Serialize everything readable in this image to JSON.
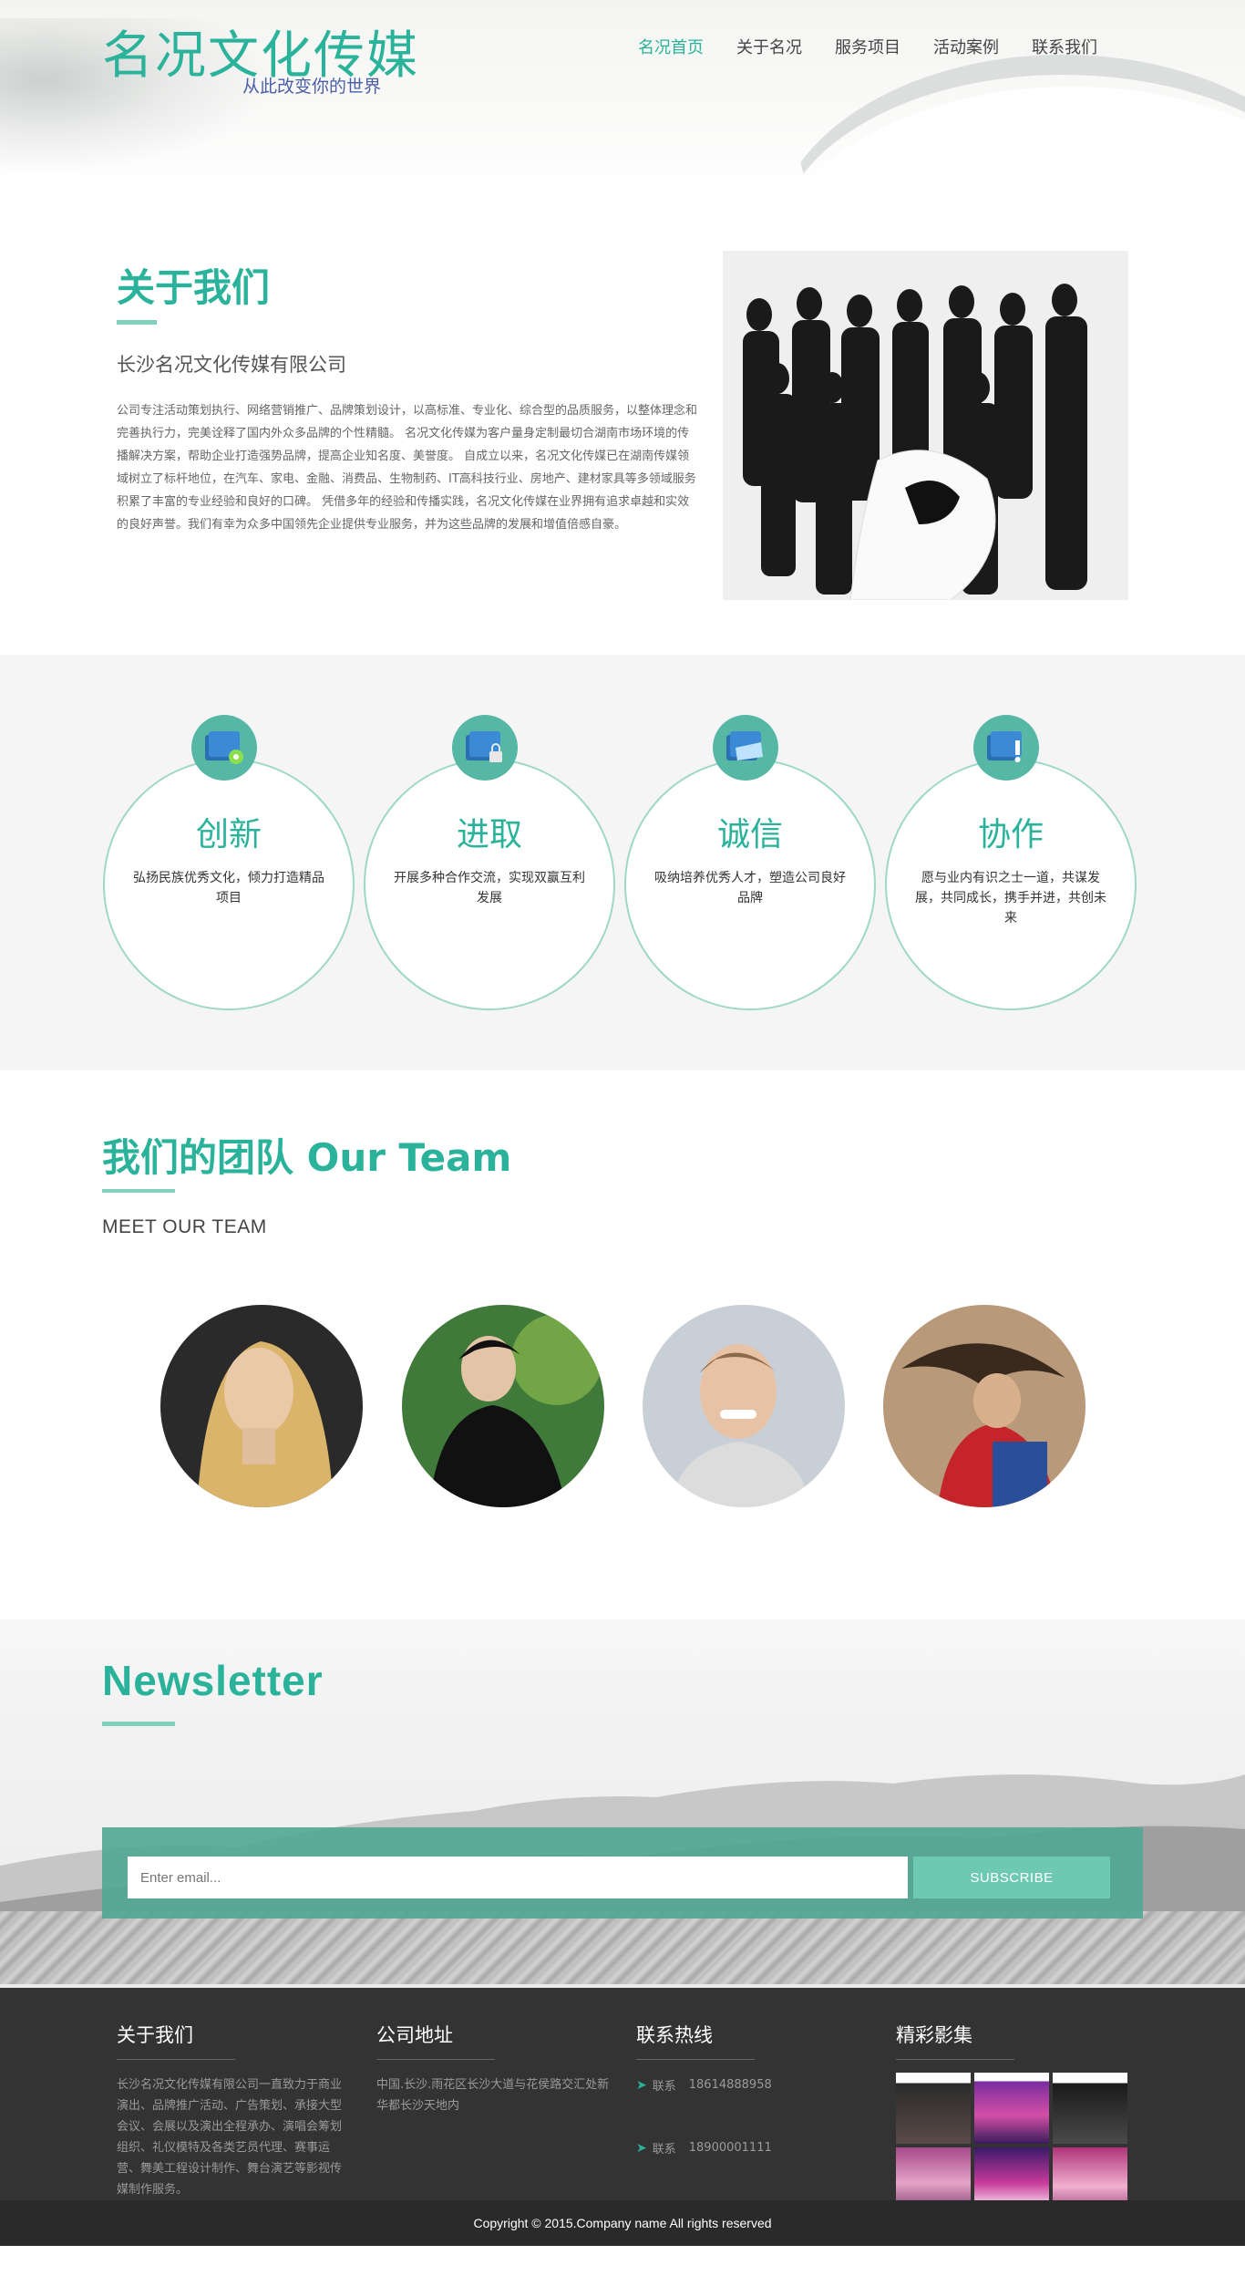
{
  "header": {
    "logo_title": "名况文化传媒",
    "logo_subtitle": "从此改变你的世界",
    "nav": [
      "名况首页",
      "关于名况",
      "服务项目",
      "活动案例",
      "联系我们"
    ],
    "active_nav": "名况首页"
  },
  "about": {
    "title": "关于我们",
    "company": "长沙名况文化传媒有限公司",
    "description": "公司专注活动策划执行、网络营销推广、品牌策划设计，以高标准、专业化、综合型的品质服务，以整体理念和完善执行力，完美诠释了国内外众多品牌的个性精髓。 名况文化传媒为客户量身定制最切合湖南市场环境的传播解决方案，帮助企业打造强势品牌，提高企业知名度、美誉度。 自成立以来，名况文化传媒已在湖南传媒领域树立了标杆地位，在汽车、家电、金融、消费品、生物制药、IT高科技行业、房地产、建材家具等多领域服务积累了丰富的专业经验和良好的口碑。 凭借多年的经验和传播实践，名况文化传媒在业界拥有追求卓越和实效的良好声誉。我们有幸为众多中国领先企业提供专业服务，并为这些品牌的发展和增值倍感自豪。"
  },
  "values": [
    {
      "title": "创新",
      "text": "弘扬民族优秀文化，倾力打造精品项目",
      "icon": "folder-gear-icon"
    },
    {
      "title": "进取",
      "text": "开展多种合作交流，实现双赢互利发展",
      "icon": "folder-lock-icon"
    },
    {
      "title": "诚信",
      "text": "吸纳培养优秀人才，塑造公司良好品牌",
      "icon": "folder-open-icon"
    },
    {
      "title": "协作",
      "text": "愿与业内有识之士一道，共谋发展，共同成长，携手并进，共创未来",
      "icon": "folder-info-icon"
    }
  ],
  "team": {
    "title": "我们的团队 Our Team",
    "subtitle": "MEET OUR TEAM",
    "members": [
      "member-1",
      "member-2",
      "member-3",
      "member-4"
    ]
  },
  "newsletter": {
    "title": "Newsletter",
    "email_placeholder": "Enter email...",
    "subscribe_label": "SUBSCRIBE"
  },
  "footer": {
    "about_title": "关于我们",
    "about_text": "长沙名况文化传媒有限公司一直致力于商业演出、品牌推广活动、广告策划、承接大型会议、会展以及演出全程承办、演唱会筹划组织、礼仪模特及各类艺员代理、赛事运营、舞美工程设计制作、舞台演艺等影视传媒制作服务。",
    "address_title": "公司地址",
    "address_text": "中国.长沙.雨花区长沙大道与花侯路交汇处新华都长沙天地内",
    "hotline_title": "联系热线",
    "contact_label": "联系",
    "phones": [
      "18614888958",
      "18900001111"
    ],
    "gallery_title": "精彩影集",
    "copyright": "Copyright © 2015.Company name All rights reserved"
  }
}
